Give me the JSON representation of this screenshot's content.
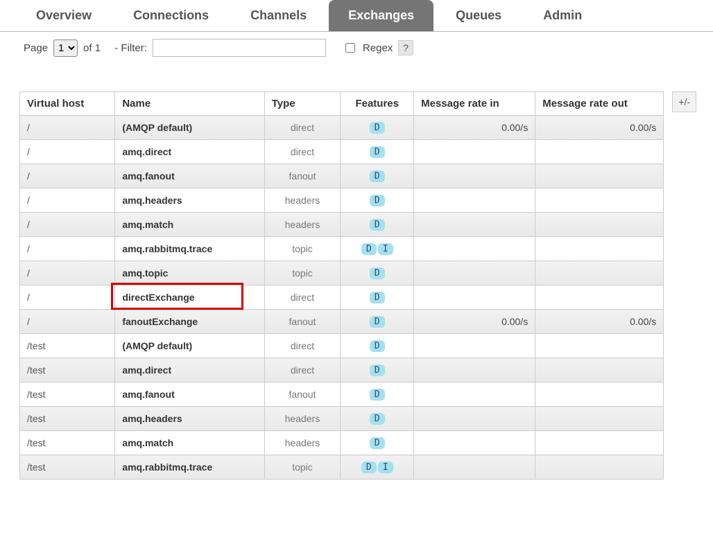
{
  "tabs": [
    "Overview",
    "Connections",
    "Channels",
    "Exchanges",
    "Queues",
    "Admin"
  ],
  "active_tab": "Exchanges",
  "filter": {
    "page_label": "Page",
    "page_value": "1",
    "of_label": "of 1",
    "filter_label": "- Filter:",
    "filter_value": "",
    "regex_label": "Regex",
    "help": "?"
  },
  "columns": {
    "vhost": "Virtual host",
    "name": "Name",
    "type": "Type",
    "features": "Features",
    "rate_in": "Message rate in",
    "rate_out": "Message rate out"
  },
  "plusminus": "+/-",
  "badges": {
    "D": "D",
    "I": "I"
  },
  "rows": [
    {
      "vhost": "/",
      "name": "(AMQP default)",
      "type": "direct",
      "features": [
        "D"
      ],
      "rate_in": "0.00/s",
      "rate_out": "0.00/s",
      "highlight": false
    },
    {
      "vhost": "/",
      "name": "amq.direct",
      "type": "direct",
      "features": [
        "D"
      ],
      "rate_in": "",
      "rate_out": "",
      "highlight": false
    },
    {
      "vhost": "/",
      "name": "amq.fanout",
      "type": "fanout",
      "features": [
        "D"
      ],
      "rate_in": "",
      "rate_out": "",
      "highlight": false
    },
    {
      "vhost": "/",
      "name": "amq.headers",
      "type": "headers",
      "features": [
        "D"
      ],
      "rate_in": "",
      "rate_out": "",
      "highlight": false
    },
    {
      "vhost": "/",
      "name": "amq.match",
      "type": "headers",
      "features": [
        "D"
      ],
      "rate_in": "",
      "rate_out": "",
      "highlight": false
    },
    {
      "vhost": "/",
      "name": "amq.rabbitmq.trace",
      "type": "topic",
      "features": [
        "D",
        "I"
      ],
      "rate_in": "",
      "rate_out": "",
      "highlight": false
    },
    {
      "vhost": "/",
      "name": "amq.topic",
      "type": "topic",
      "features": [
        "D"
      ],
      "rate_in": "",
      "rate_out": "",
      "highlight": false
    },
    {
      "vhost": "/",
      "name": "directExchange",
      "type": "direct",
      "features": [
        "D"
      ],
      "rate_in": "",
      "rate_out": "",
      "highlight": true
    },
    {
      "vhost": "/",
      "name": "fanoutExchange",
      "type": "fanout",
      "features": [
        "D"
      ],
      "rate_in": "0.00/s",
      "rate_out": "0.00/s",
      "highlight": false
    },
    {
      "vhost": "/test",
      "name": "(AMQP default)",
      "type": "direct",
      "features": [
        "D"
      ],
      "rate_in": "",
      "rate_out": "",
      "highlight": false
    },
    {
      "vhost": "/test",
      "name": "amq.direct",
      "type": "direct",
      "features": [
        "D"
      ],
      "rate_in": "",
      "rate_out": "",
      "highlight": false
    },
    {
      "vhost": "/test",
      "name": "amq.fanout",
      "type": "fanout",
      "features": [
        "D"
      ],
      "rate_in": "",
      "rate_out": "",
      "highlight": false
    },
    {
      "vhost": "/test",
      "name": "amq.headers",
      "type": "headers",
      "features": [
        "D"
      ],
      "rate_in": "",
      "rate_out": "",
      "highlight": false
    },
    {
      "vhost": "/test",
      "name": "amq.match",
      "type": "headers",
      "features": [
        "D"
      ],
      "rate_in": "",
      "rate_out": "",
      "highlight": false
    },
    {
      "vhost": "/test",
      "name": "amq.rabbitmq.trace",
      "type": "topic",
      "features": [
        "D",
        "I"
      ],
      "rate_in": "",
      "rate_out": "",
      "highlight": false
    }
  ]
}
